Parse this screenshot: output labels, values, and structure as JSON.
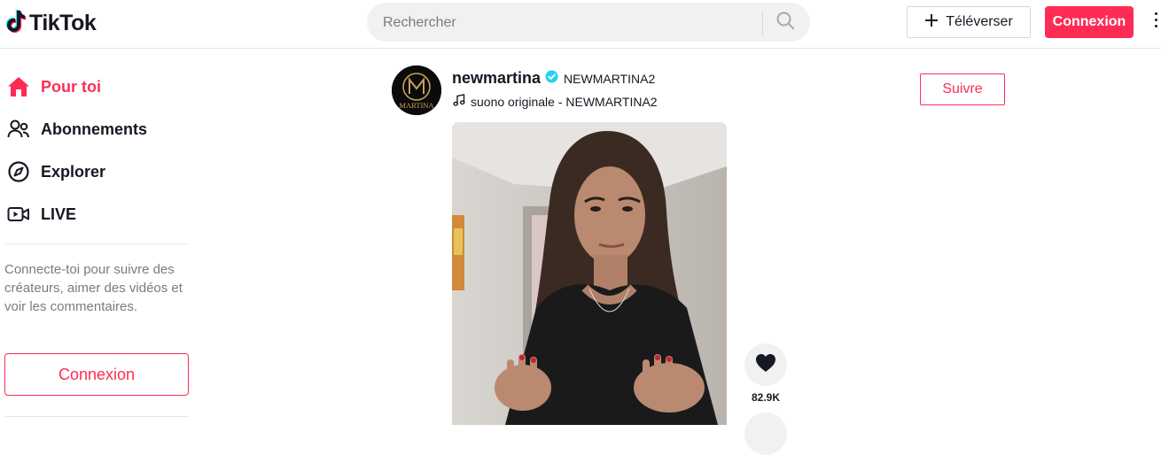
{
  "header": {
    "logo_text": "TikTok",
    "search_placeholder": "Rechercher",
    "upload_label": "Téléverser",
    "login_label": "Connexion"
  },
  "sidebar": {
    "items": [
      {
        "label": "Pour toi",
        "icon": "home-icon",
        "active": true
      },
      {
        "label": "Abonnements",
        "icon": "following-icon",
        "active": false
      },
      {
        "label": "Explorer",
        "icon": "compass-icon",
        "active": false
      },
      {
        "label": "LIVE",
        "icon": "live-icon",
        "active": false
      }
    ],
    "login_prompt": "Connecte-toi pour suivre des créateurs, aimer des vidéos et voir les commentaires.",
    "login_label": "Connexion"
  },
  "post": {
    "author_name": "newmartina",
    "author_nickname": "NEWMARTINA2",
    "verified": true,
    "music": "suono originale - NEWMARTINA2",
    "follow_label": "Suivre",
    "avatar_text": "MARTINA",
    "like_count": "82.9K"
  },
  "colors": {
    "accent": "#fe2c55",
    "verified": "#20d5ec",
    "text": "#161823",
    "muted": "#7a7b82"
  }
}
